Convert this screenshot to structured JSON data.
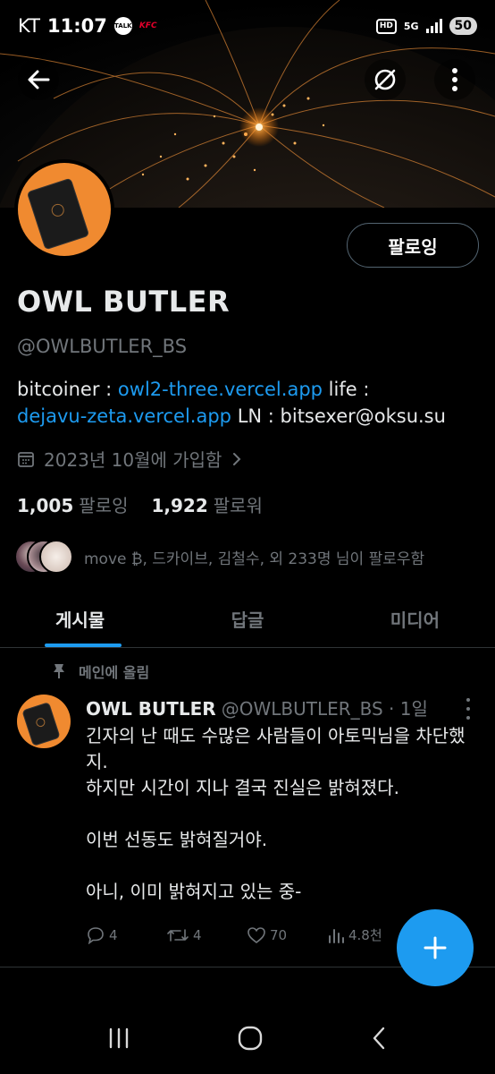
{
  "status_bar": {
    "carrier": "KT",
    "time": "11:07",
    "talk_badge": "TALK",
    "kfc_badge": "KFC",
    "hd": "HD",
    "network": "5G",
    "battery": "50"
  },
  "header": {
    "back_icon": "arrow-left-icon",
    "action_icon": "slash-circle-icon",
    "more_icon": "vertical-dots-icon"
  },
  "profile": {
    "follow_button": "팔로잉",
    "name": "OWL BUTLER",
    "handle": "@OWLBUTLER_BS",
    "bio": {
      "prefix": "bitcoiner : ",
      "link1": "owl2-three.vercel.app",
      "middle": " life : ",
      "link2": "dejavu-zeta.vercel.app",
      "suffix": " LN : bitsexer@oksu.su"
    },
    "joined": "2023년 10월에 가입함",
    "following_count": "1,005",
    "following_label": "팔로잉",
    "followers_count": "1,922",
    "followers_label": "팔로워",
    "followed_by": "move ₿, 드카이브, 김철수, 외 233명 님이 팔로우함"
  },
  "tabs": [
    {
      "label": "게시물",
      "active": true
    },
    {
      "label": "답글",
      "active": false
    },
    {
      "label": "미디어",
      "active": false
    }
  ],
  "post": {
    "pinned_label": "메인에 올림",
    "author_name": "OWL BUTLER",
    "author_handle": "@OWLBUTLER_BS",
    "time": "· 1일",
    "text": "긴자의 난 때도 수많은 사람들이 아토믹님을 차단했지.\n하지만 시간이 지나 결국 진실은 밝혀졌다.\n\n이번 선동도 밝혀질거야.\n\n아니, 이미 밝혀지고 있는 중-",
    "replies": "4",
    "reposts": "4",
    "likes": "70",
    "views": "4.8천"
  },
  "colors": {
    "accent": "#1d9bf0",
    "avatar_bg": "#f08a30",
    "muted": "#71767b"
  }
}
